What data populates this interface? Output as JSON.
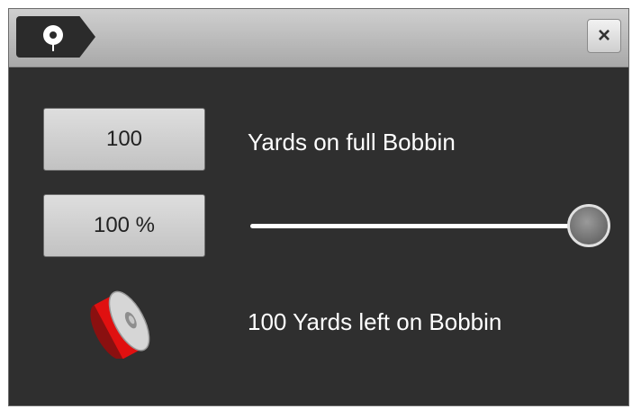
{
  "dialog": {
    "close_label": "×"
  },
  "bobbin": {
    "yards_full_value": "100",
    "yards_full_label": "Yards on full Bobbin",
    "percent_value": "100 %",
    "slider_value_percent": 100,
    "yards_left_label": "100 Yards left on Bobbin"
  },
  "colors": {
    "panel_background": "#2f2f2f",
    "bobbin_thread": "#e01010",
    "text": "#ffffff"
  },
  "icons": {
    "title": "bobbin-icon",
    "close": "close-icon",
    "bobbin_status": "bobbin-spool-icon"
  }
}
